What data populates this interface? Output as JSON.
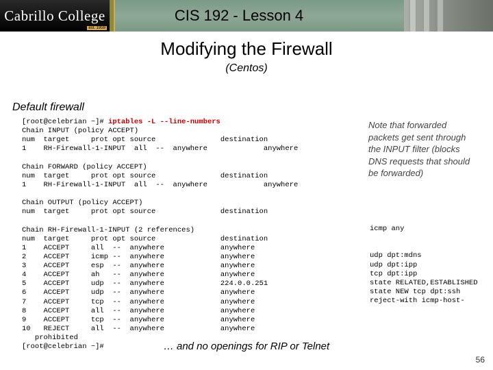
{
  "banner": {
    "logo": "Cabrillo College",
    "est": "est. 1959",
    "title": "CIS 192 - Lesson 4"
  },
  "heading": "Modifying the Firewall",
  "subhead": "(Centos)",
  "section": "Default firewall",
  "note": "Note that forwarded packets get sent through the INPUT filter (blocks DNS requests that should be forwarded)",
  "term": {
    "prompt1": "[root@celebrian ~]# ",
    "cmd": "iptables -L --line-numbers",
    "l01": "Chain INPUT (policy ACCEPT)",
    "l02": "num  target     prot opt source               destination",
    "l03": "1    RH-Firewall-1-INPUT  all  --  anywhere             anywhere",
    "l04": "",
    "l05": "Chain FORWARD (policy ACCEPT)",
    "l06": "num  target     prot opt source               destination",
    "l07": "1    RH-Firewall-1-INPUT  all  --  anywhere             anywhere",
    "l08": "",
    "l09": "Chain OUTPUT (policy ACCEPT)",
    "l10": "num  target     prot opt source               destination",
    "l11": "",
    "l12": "Chain RH-Firewall-1-INPUT (2 references)",
    "l13": "num  target     prot opt source               destination",
    "l14": "1    ACCEPT     all  --  anywhere             anywhere",
    "l15": "2    ACCEPT     icmp --  anywhere             anywhere",
    "l16": "3    ACCEPT     esp  --  anywhere             anywhere",
    "l17": "4    ACCEPT     ah   --  anywhere             anywhere",
    "l18": "5    ACCEPT     udp  --  anywhere             224.0.0.251",
    "l19": "6    ACCEPT     udp  --  anywhere             anywhere",
    "l20": "7    ACCEPT     tcp  --  anywhere             anywhere",
    "l21": "8    ACCEPT     all  --  anywhere             anywhere",
    "l22": "9    ACCEPT     tcp  --  anywhere             anywhere",
    "l23": "10   REJECT     all  --  anywhere             anywhere",
    "l24": "   prohibited",
    "l25": "[root@celebrian ~]#"
  },
  "extras": {
    "e15": "icmp any",
    "e16": "",
    "e17": "",
    "e18": "udp dpt:mdns",
    "e19": "udp dpt:ipp",
    "e20": "tcp dpt:ipp",
    "e21": "state RELATED,ESTABLISHED",
    "e22": "state NEW tcp dpt:ssh",
    "e23": "reject-with icmp-host-"
  },
  "footer": "… and no openings for RIP or Telnet",
  "pagenum": "56"
}
